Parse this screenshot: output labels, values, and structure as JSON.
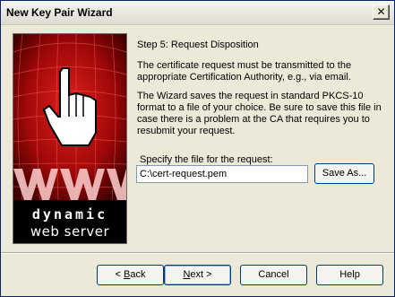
{
  "window": {
    "title": "New Key Pair Wizard",
    "close_glyph": "✕"
  },
  "banner": {
    "brand_line1": "dynamic",
    "brand_line2": "web server",
    "icon": "pointing-hand-cursor-icon"
  },
  "content": {
    "step_title": "Step 5: Request Disposition",
    "paragraph1": "The certificate request must be transmitted to the appropriate Certification Authority, e.g., via email.",
    "paragraph2": "The Wizard saves the request in standard PKCS-10 format to a file of your choice. Be sure to save this file in case there is a problem at the CA that requires you to resubmit your request.",
    "file_label": "Specify the file for the request:",
    "file_value": "C:\\cert-request.pem",
    "save_as_label": "Save As..."
  },
  "buttons": {
    "back_prefix": "< ",
    "back_mnemonic": "B",
    "back_rest": "ack",
    "next_mnemonic": "N",
    "next_rest": "ext >",
    "cancel": "Cancel",
    "help": "Help"
  },
  "colors": {
    "banner_red": "#b01010",
    "dialog_bg": "#ece9d8"
  }
}
